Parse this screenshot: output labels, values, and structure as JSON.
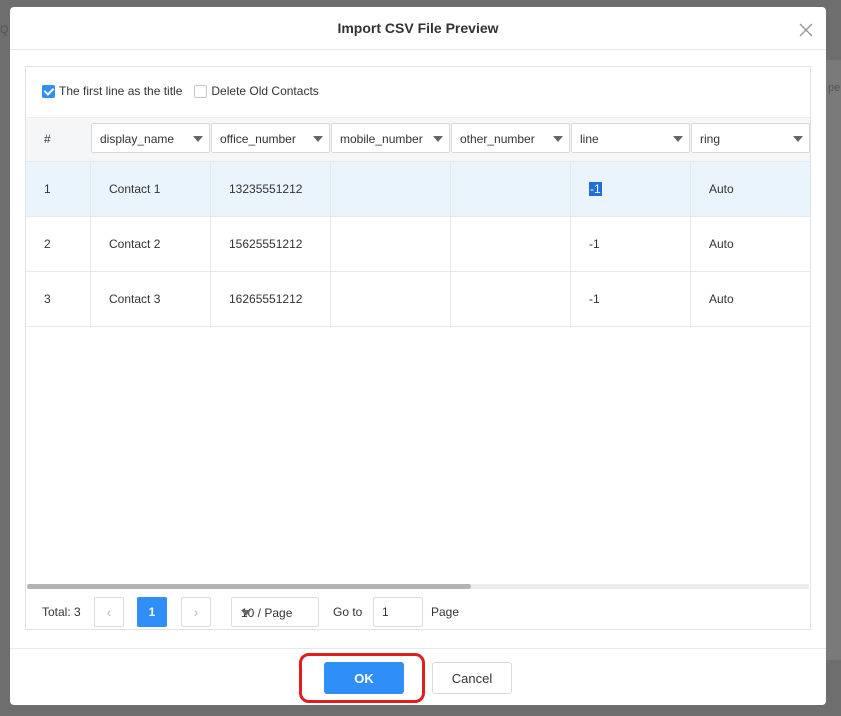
{
  "dialog": {
    "title": "Import CSV File Preview",
    "close_icon": "close-icon"
  },
  "options": {
    "first_line_title": {
      "label": "The first line as the title",
      "checked": true
    },
    "delete_old_contacts": {
      "label": "Delete Old Contacts",
      "checked": false
    }
  },
  "table": {
    "hash_header": "#",
    "columns": [
      "display_name",
      "office_number",
      "mobile_number",
      "other_number",
      "line",
      "ring"
    ],
    "rows": [
      {
        "index": "1",
        "display_name": "Contact 1",
        "office_number": "13235551212",
        "mobile_number": "",
        "other_number": "",
        "line": "-1",
        "ring": "Auto"
      },
      {
        "index": "2",
        "display_name": "Contact 2",
        "office_number": "15625551212",
        "mobile_number": "",
        "other_number": "",
        "line": "-1",
        "ring": "Auto"
      },
      {
        "index": "3",
        "display_name": "Contact 3",
        "office_number": "16265551212",
        "mobile_number": "",
        "other_number": "",
        "line": "-1",
        "ring": "Auto"
      }
    ]
  },
  "pagination": {
    "total": "Total: 3",
    "current_page": "1",
    "page_size": "10 / Page",
    "goto_label": "Go to",
    "goto_value": "1",
    "page_label": "Page"
  },
  "footer": {
    "ok_label": "OK",
    "cancel_label": "Cancel"
  },
  "colors": {
    "accent": "#2f8ef7",
    "selected_row": "#e9f4fd",
    "highlight_ring": "#e01e1e"
  }
}
